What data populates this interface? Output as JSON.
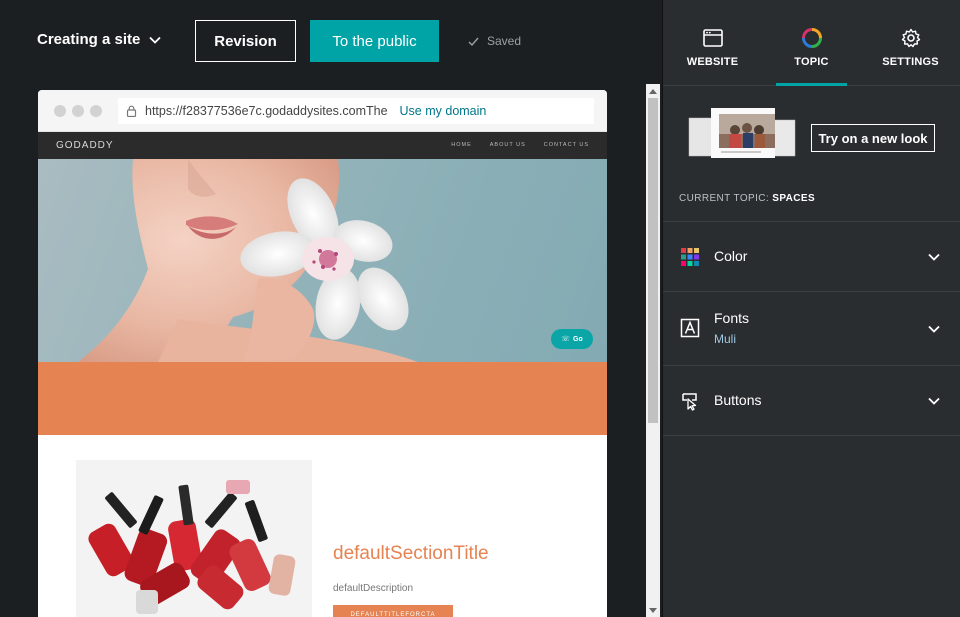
{
  "topbar": {
    "site_label": "Creating a site",
    "revision_label": "Revision",
    "publish_label": "To the public",
    "saved_label": "Saved"
  },
  "preview": {
    "url": "https://f28377536e7c.godaddysites.comThe",
    "use_domain": "Use my domain",
    "site_logo": "GODADDY",
    "nav_links": [
      "HOME",
      "ABOUT US",
      "CONTACT US"
    ],
    "go_label": "Go",
    "section_title": "defaultSectionTitle",
    "section_description": "defaultDescription",
    "section_button": "DEFAULTTITLEFORCTA"
  },
  "panel": {
    "tabs": [
      {
        "label": "WEBSITE",
        "icon": "browser-window-icon",
        "active": false
      },
      {
        "label": "TOPIC",
        "icon": "color-ring-icon",
        "active": true
      },
      {
        "label": "SETTINGS",
        "icon": "gear-icon",
        "active": false
      }
    ],
    "try_label": "Try on a new look",
    "current_topic_label": "CURRENT TOPIC:",
    "current_topic_value": "SPACES",
    "sections": [
      {
        "title": "Color",
        "subtitle": "",
        "icon": "palette-grid-icon"
      },
      {
        "title": "Fonts",
        "subtitle": "Muli",
        "icon": "font-icon"
      },
      {
        "title": "Buttons",
        "subtitle": "",
        "icon": "button-icon"
      }
    ]
  },
  "colors": {
    "accent": "#00a4a6",
    "background": "#1c1f22",
    "panel": "#2a2d30",
    "site_accent": "#e58352"
  }
}
